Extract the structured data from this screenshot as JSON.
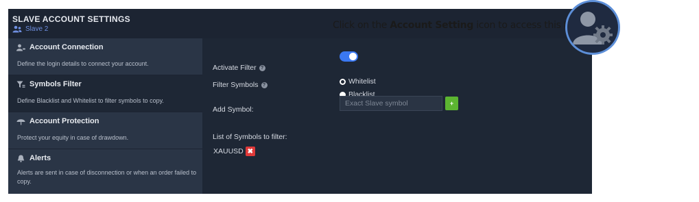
{
  "header": {
    "title": "SLAVE ACCOUNT SETTINGS",
    "subtitle": "Slave 2"
  },
  "sidebar": {
    "items": [
      {
        "title": "Account Connection",
        "desc": "Define the login details to connect your account.",
        "icon": "user-link-icon"
      },
      {
        "title": "Symbols Filter",
        "desc": "Define Blacklist and Whitelist to filter symbols to copy.",
        "icon": "filter-icon",
        "active": true
      },
      {
        "title": "Account Protection",
        "desc": "Protect your equity in case of drawdown.",
        "icon": "umbrella-icon"
      },
      {
        "title": "Alerts",
        "desc": "Alerts are sent in case of disconnection or when an order failed to copy.",
        "icon": "bell-icon"
      }
    ]
  },
  "form": {
    "activate_filter_label": "Activate Filter",
    "filter_symbols_label": "Filter Symbols",
    "whitelist_label": "Whitelist",
    "blacklist_label": "Blacklist",
    "add_symbol_label": "Add Symbol:",
    "symbol_placeholder": "Exact Slave symbol",
    "add_button": "+",
    "list_label": "List of Symbols to filter:",
    "help_glyph": "?",
    "symbols": [
      "XAUUSD"
    ],
    "remove_glyph": "✖",
    "filter_active": true,
    "selected_mode": "Whitelist"
  },
  "tip": {
    "prefix": "Click on the ",
    "bold": "Account Setting",
    "suffix": " icon to access this tab"
  },
  "colors": {
    "panel": "#1e2735",
    "sidebar": "#2a3546",
    "accent": "#3a78f2",
    "add": "#5cb531",
    "remove": "#e03a3a"
  }
}
